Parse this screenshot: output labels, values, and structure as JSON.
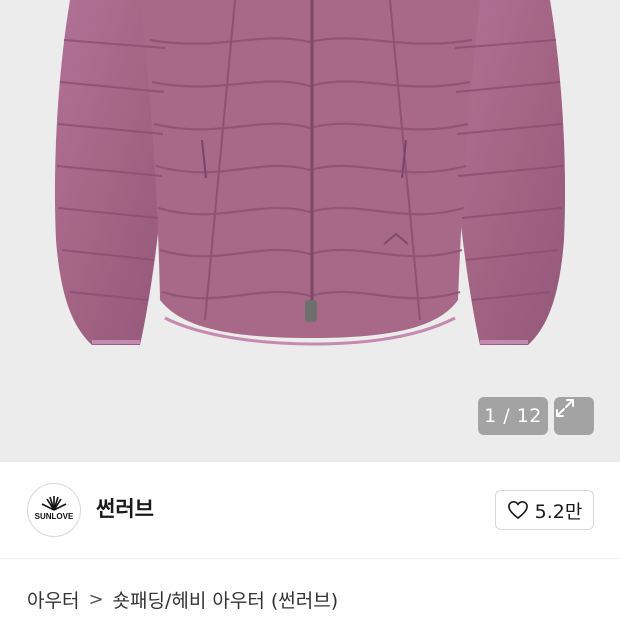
{
  "gallery": {
    "counter_text": "1 / 12",
    "current_index": 1,
    "total_images": 12,
    "product_color": "#a66585",
    "background_color": "#ececec"
  },
  "brand": {
    "logo_text": "SUNLOVE",
    "name": "썬러브"
  },
  "like": {
    "count": "5.2만"
  },
  "breadcrumb": {
    "category": "아우터",
    "separator": ">",
    "subcategory": "숏패딩/헤비 아우터 (썬러브)"
  }
}
